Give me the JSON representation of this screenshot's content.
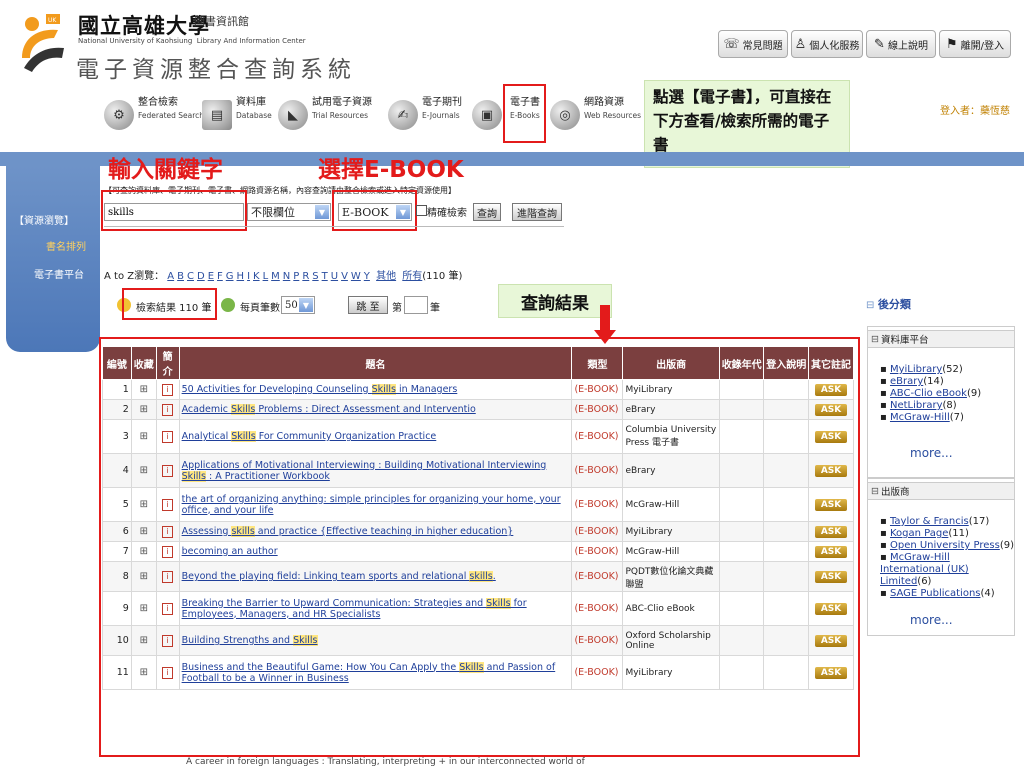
{
  "header": {
    "university_zh": "國立高雄大學",
    "library_zh": "圖書資訊館",
    "university_en": "National University of Kaohsiung",
    "library_en": "Library And Information Center",
    "system_title": "電子資源整合查詢系統",
    "buttons": [
      {
        "label": "常見問題",
        "icon": "help-icon"
      },
      {
        "label": "個人化服務",
        "icon": "person-icon"
      },
      {
        "label": "線上說明",
        "icon": "book-icon"
      },
      {
        "label": "離開/登入",
        "icon": "door-icon"
      }
    ]
  },
  "nav": {
    "items": [
      {
        "zh": "整合檢索",
        "en": "Federated Search"
      },
      {
        "zh": "資料庫",
        "en": "Database"
      },
      {
        "zh": "試用電子資源",
        "en": "Trial Resources"
      },
      {
        "zh": "電子期刊",
        "en": "E-Journals"
      },
      {
        "zh": "電子書",
        "en": "E-Books"
      },
      {
        "zh": "網路資源",
        "en": "Web Resources"
      }
    ],
    "login_user": "登入者：藥恆慈"
  },
  "sidebar": {
    "items": [
      "【資源瀏覽】",
      "書名排列",
      "電子書平台"
    ]
  },
  "annotations": {
    "enter_keyword": "輸入關鍵字",
    "select_ebook": "選擇E-BOOK",
    "tip": "點選【電子書】，可直接在下方查看/檢索所需的電子書",
    "results": "查詢結果"
  },
  "search": {
    "hint": "【可查詢資料庫、電子期刊、電子書、網路資源名稱，內容查詢請由整合檢索或進入特定資源使用】",
    "keyword": "skills",
    "field": "不限欄位",
    "type": "E-BOOK",
    "exact_label": "精確檢索",
    "search_button": "查詢",
    "advanced_button": "進階查詢"
  },
  "az": {
    "label": "A to Z瀏覽：",
    "letters": [
      "A",
      "B",
      "C",
      "D",
      "E",
      "F",
      "G",
      "H",
      "I",
      "K",
      "L",
      "M",
      "N",
      "P",
      "R",
      "S",
      "T",
      "U",
      "V",
      "W",
      "Y"
    ],
    "other": "其他",
    "all": "所有",
    "total": "(110 筆)"
  },
  "results_bar": {
    "count": "檢索結果 110 筆",
    "per_page_label": "每頁筆數",
    "per_page": "50",
    "jump_button": "跳 至",
    "page_prefix": "第",
    "page_suffix": "筆"
  },
  "table": {
    "headers": [
      "編號",
      "收藏",
      "簡介",
      "題名",
      "類型",
      "出版商",
      "收錄年代",
      "登入說明",
      "其它註記"
    ],
    "rows": [
      {
        "no": "1",
        "title_pre": "50 Activities for Developing Counseling ",
        "kw": "Skills",
        "title_post": " in Managers",
        "type": "(E-BOOK)",
        "publisher": "MyiLibrary"
      },
      {
        "no": "2",
        "title_pre": "Academic ",
        "kw": "Skills",
        "title_post": " Problems : Direct Assessment and Interventio",
        "type": "(E-BOOK)",
        "publisher": "eBrary"
      },
      {
        "no": "3",
        "title_pre": "Analytical ",
        "kw": "Skills",
        "title_post": " For Community Organization Practice",
        "type": "(E-BOOK)",
        "publisher": "Columbia University Press 電子書"
      },
      {
        "no": "4",
        "title_pre": "Applications of Motivational Interviewing : Building Motivational Interviewing ",
        "kw": "Skills",
        "title_post": " : A Practitioner Workbook",
        "type": "(E-BOOK)",
        "publisher": "eBrary"
      },
      {
        "no": "5",
        "title_pre": "the art of organizing anything: simple principles for organizing your home, your office, and your life",
        "kw": "",
        "title_post": "",
        "type": "(E-BOOK)",
        "publisher": "McGraw-Hill"
      },
      {
        "no": "6",
        "title_pre": "Assessing ",
        "kw": "skills",
        "title_post": " and practice {Effective teaching in higher education}",
        "type": "(E-BOOK)",
        "publisher": "MyiLibrary"
      },
      {
        "no": "7",
        "title_pre": "becoming an author",
        "kw": "",
        "title_post": "",
        "type": "(E-BOOK)",
        "publisher": "McGraw-Hill"
      },
      {
        "no": "8",
        "title_pre": "Beyond the playing field:  Linking team sports and relational ",
        "kw": "skills",
        "title_post": ".",
        "type": "(E-BOOK)",
        "publisher": "PQDT數位化論文典藏聯盟"
      },
      {
        "no": "9",
        "title_pre": "Breaking the Barrier to Upward Communication: Strategies and ",
        "kw": "Skills",
        "title_post": " for Employees, Managers, and HR Specialists",
        "type": "(E-BOOK)",
        "publisher": "ABC-Clio eBook"
      },
      {
        "no": "10",
        "title_pre": "Building Strengths and ",
        "kw": "Skills",
        "title_post": "",
        "type": "(E-BOOK)",
        "publisher": "Oxford Scholarship Online"
      },
      {
        "no": "11",
        "title_pre": "Business and the Beautiful Game: How You Can Apply the ",
        "kw": "Skills",
        "title_post": " and Passion of Football to be a Winner in Business",
        "type": "(E-BOOK)",
        "publisher": "MyiLibrary"
      }
    ],
    "ask_label": "ASK",
    "partial_row": "A career in foreign languages : Translating, interpreting + in our interconnected world of"
  },
  "facets": {
    "title": "後分類",
    "groups": [
      {
        "name": "資料庫平台",
        "items": [
          {
            "label": "MyiLibrary",
            "count": "(52)"
          },
          {
            "label": "eBrary",
            "count": "(14)"
          },
          {
            "label": "ABC-Clio eBook",
            "count": "(9)"
          },
          {
            "label": "NetLibrary",
            "count": "(8)"
          },
          {
            "label": "McGraw-Hill",
            "count": "(7)"
          }
        ]
      },
      {
        "name": "出版商",
        "items": [
          {
            "label": "Taylor & Francis",
            "count": "(17)"
          },
          {
            "label": "Kogan Page",
            "count": "(11)"
          },
          {
            "label": "Open University Press",
            "count": "(9)"
          },
          {
            "label": "McGraw-Hill International (UK) Limited",
            "count": "(6)"
          },
          {
            "label": "SAGE Publications",
            "count": "(4)"
          }
        ]
      }
    ],
    "more": "more..."
  }
}
